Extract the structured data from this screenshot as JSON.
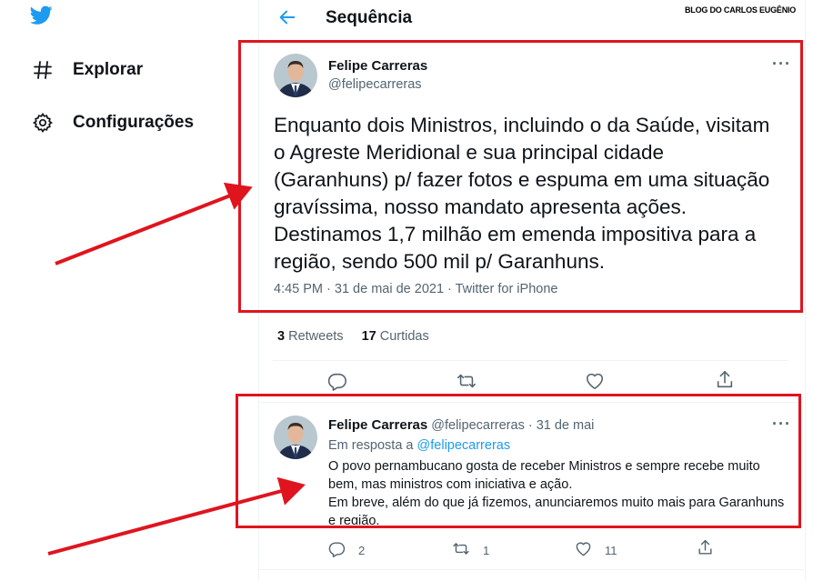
{
  "sidebar": {
    "logo_icon": "twitter-bird-icon",
    "items": [
      {
        "label": "Explorar",
        "icon": "hashtag-icon"
      },
      {
        "label": "Configurações",
        "icon": "gear-icon"
      }
    ]
  },
  "header": {
    "title": "Sequência",
    "back_icon": "arrow-left-icon"
  },
  "watermark": "BLOG DO CARLOS EUGÊNIO",
  "main_tweet": {
    "name": "Felipe Carreras",
    "handle": "@felipecarreras",
    "text": "Enquanto dois Ministros, incluindo o da Saúde, visitam o Agreste Meridional e sua principal cidade (Garanhuns) p/ fazer fotos e espuma em uma situação gravíssima, nosso mandato apresenta ações. Destinamos 1,7 milhão em emenda impositiva para a região, sendo 500 mil p/ Garanhuns.",
    "meta": "4:45 PM · 31 de mai de 2021 · Twitter for iPhone",
    "retweets_count": "3",
    "retweets_label": "Retweets",
    "likes_count": "17",
    "likes_label": "Curtidas"
  },
  "reply_tweet": {
    "name": "Felipe Carreras",
    "handle_date": "@felipecarreras · 31 de mai",
    "in_reply_prefix": "Em resposta a",
    "in_reply_handle": "@felipecarreras",
    "line1": "O povo pernambucano gosta de receber Ministros e sempre recebe muito bem, mas ministros com iniciativa e ação.",
    "line2": "Em breve, além do que já fizemos,  anunciaremos muito mais para Garanhuns e região.",
    "replies": "2",
    "retweets": "1",
    "likes": "11"
  },
  "colors": {
    "accent": "#1d9bf0",
    "annotation": "#e0141e"
  }
}
